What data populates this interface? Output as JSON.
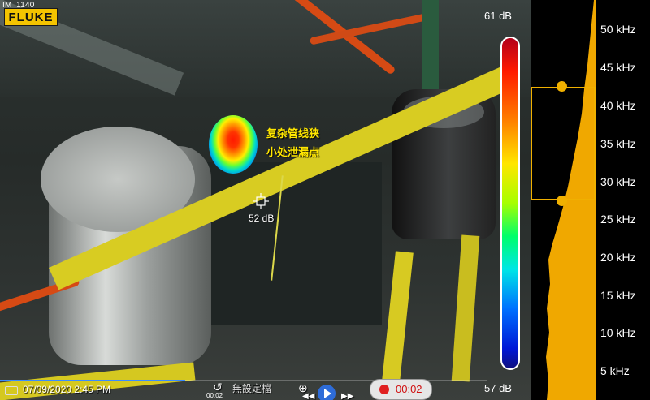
{
  "file_id": "IM_1140",
  "brand": {
    "logo_text": "FLUKE"
  },
  "db_scale": {
    "max_label": "61 dB",
    "min_label": "57 dB",
    "spot_label": "52 dB"
  },
  "annotation": {
    "line1": "复杂管线狭",
    "line2": "小处泄漏点"
  },
  "timestamp": "07/09/2020  2:45 PM",
  "spectrum": {
    "freq_labels": [
      "50 kHz",
      "45 kHz",
      "40 kHz",
      "35 kHz",
      "30 kHz",
      "25 kHz",
      "20 kHz",
      "15 kHz",
      "10 kHz",
      "5 kHz"
    ],
    "selection_khz": [
      28,
      43
    ],
    "colors": {
      "fill": "#f0a800",
      "selection": "#f0b000"
    }
  },
  "controls": {
    "time_small": "00:02",
    "label": "無設定檔",
    "record_time": "00:02",
    "progress": 0.38,
    "icons": [
      "rewind-icon",
      "zoom-icon",
      "previous-icon",
      "play-icon",
      "next-icon",
      "record-icon"
    ]
  }
}
